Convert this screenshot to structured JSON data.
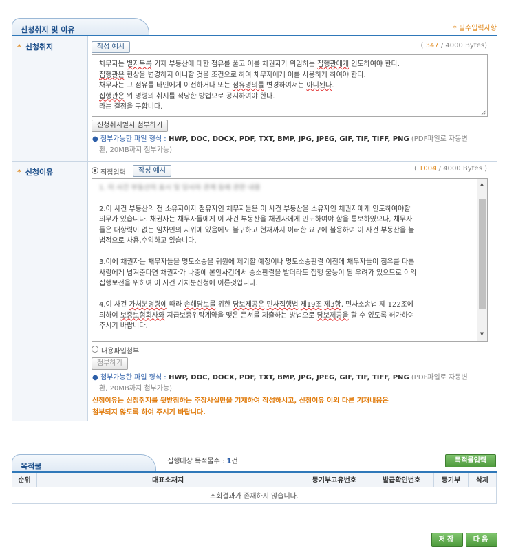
{
  "section1": {
    "title": "신청취지 및 이유",
    "required_note": "* 필수입력사항"
  },
  "purpose": {
    "label": "신청취지",
    "example_button": "작성 예시",
    "byte_count": "347",
    "byte_max": "/ 4000 Bytes)",
    "byte_open": "(",
    "lines": [
      [
        "채무자는 ",
        {
          "w": "별지목록"
        },
        " 기재 부동산에 대한 점유를 풀고 이를 채권자가 위임하는 ",
        {
          "w": "집행관에게"
        },
        " 인도하여야 한다."
      ],
      [
        {
          "w": "집행관은"
        },
        " 현상을 변경하지 아니할 것을 조건으로 하여 채무자에게 이를 사용하게 하여야 한다."
      ],
      [
        "채무자는 그 점유를 타인에게 이전하거나 또는 ",
        {
          "w": "점유명의를"
        },
        " 변경하여서는 ",
        {
          "w": "아니된다"
        },
        "."
      ],
      [
        {
          "w": "집행관은"
        },
        " 위 명령의 취지를 적당한 방법으로 공시하여야 한다."
      ],
      [
        "라는 결정을 구합니다."
      ]
    ],
    "attach_button": "신청취지별지 첨부하기",
    "hint_prefix": "● 첨부가능한 파일 형식 :",
    "hint_formats": " HWP, DOC, DOCX, PDF, TXT, BMP, JPG, JPEG, GIF, TIF, TIFF, PNG",
    "hint_suffix": "(PDF파일로 자동변",
    "hint_line2": "환, 20MB까지 첨부가능)"
  },
  "reason": {
    "label": "신청이유",
    "radio_direct": "직접입력",
    "example_button": "작성 예시",
    "byte_open": "(",
    "byte_count": "1004",
    "byte_max": "/ 4000 Bytes )",
    "blurred_line": "1. 이 사건 부동산의 표시 및 당사자 관계 등에 관한 내용",
    "paragraphs": [
      [
        [
          "2.이 사건 부동산의 전 소유자이자 점유자인 채무자들은 이 사건 부동산을 소유자인 채권자에게 인도하여야할"
        ],
        [
          "의무가 있습니다. 채권자는 채무자들에게 이 사건 부동산을 채권자에게 인도하여야 함을 통보하였으나, 채무자"
        ],
        [
          "들은 대항력이 없는 임차인의 지위에 있음에도 불구하고 현재까지 이러한 요구에 불응하여 이 사건 부동산을 불"
        ],
        [
          "법적으로 사용,수익하고 있습니다."
        ]
      ],
      [
        [
          "3.이에 채권자는 채무자들을 명도소송을 귀원에 제기할 예정이나 명도소송판결 이전에 채무자들이 점유를 다른"
        ],
        [
          "사람에게 넘겨준다면 채권자가 나중에 본안사건에서 승소판결을 받더라도 집행 불능이 될 우려가 있으므로 이의"
        ],
        [
          "집행보전을 위하여 이 사건 가처분신청에 이른것입니다."
        ]
      ],
      [
        [
          "4.이 사건 ",
          {
            "w": "가처분명령에"
          },
          " 따라 ",
          {
            "w": "손해담보를"
          },
          " 위한 ",
          {
            "w": "담보제공은"
          },
          " ",
          {
            "w": "민사집행법"
          },
          " ",
          {
            "w": "제19조"
          },
          " ",
          {
            "w": "제3항"
          },
          ", 민사소송법 제 122조에"
        ],
        [
          "의하여 ",
          {
            "w": "보증보험회사와"
          },
          " 지급보증위탁계약을 맺은 문서를 제출하는 방법으로 ",
          {
            "w": "담보제공을"
          },
          " 할 수 있도록 허가하여"
        ],
        [
          "주시기 바랍니다."
        ]
      ]
    ],
    "radio_file": "내용파일첨부",
    "attach_button": "첨부하기",
    "hint_prefix": "● 첨부가능한 파일 형식 :",
    "hint_formats": " HWP, DOC, DOCX, PDF, TXT, BMP, JPG, JPEG, GIF, TIF, TIFF, PNG",
    "hint_suffix": "(PDF파일로 자동변",
    "hint_line2": "환, 20MB까지 첨부가능)",
    "warning_line1": "신청이유는 신청취지를 뒷받침하는 주장사실만을 기재하여 작성하시고, 신청이유 이외 다른 기재내용은",
    "warning_line2": "첨부되지 않도록 하여 주시기 바랍니다."
  },
  "section2": {
    "title": "목적물",
    "count_label": "집행대상 목적물수 :",
    "count_value": "1",
    "count_unit": "건",
    "input_button": "목적물입력",
    "columns": [
      "순위",
      "대표소재지",
      "등기부고유번호",
      "발급확인번호",
      "등기부",
      "삭제"
    ],
    "empty_message": "조회결과가 존재하지 않습니다."
  },
  "footer": {
    "save_button": "저장",
    "next_button": "다음"
  },
  "colors": {
    "accent_blue": "#2f78b9",
    "required_orange": "#e08a1e",
    "button_green": "#4f9a3d"
  }
}
